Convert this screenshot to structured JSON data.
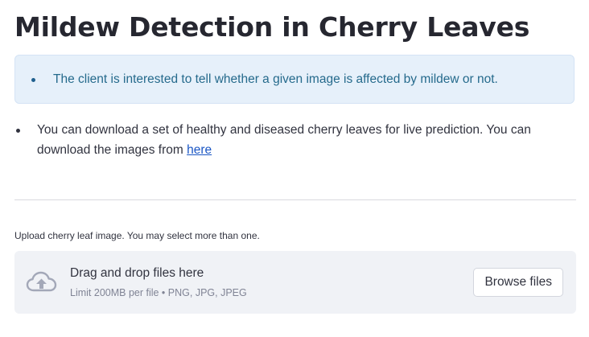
{
  "title": "Mildew Detection in Cherry Leaves",
  "info": {
    "text": "The client is interested to tell whether a given image is affected by mildew or not."
  },
  "download": {
    "text": "You can download a set of healthy and diseased cherry leaves for live prediction. You can download the images from ",
    "link_label": "here"
  },
  "uploader": {
    "label": "Upload cherry leaf image. You may select more than one.",
    "drop_text": "Drag and drop files here",
    "limit_text": "Limit 200MB per file • PNG, JPG, JPEG",
    "browse_label": "Browse files",
    "icon": "cloud-upload-icon"
  },
  "colors": {
    "info_bg": "#e6f0fa",
    "info_text": "#256a8c",
    "link": "#1a56c4",
    "dropzone_bg": "#f0f2f6"
  }
}
